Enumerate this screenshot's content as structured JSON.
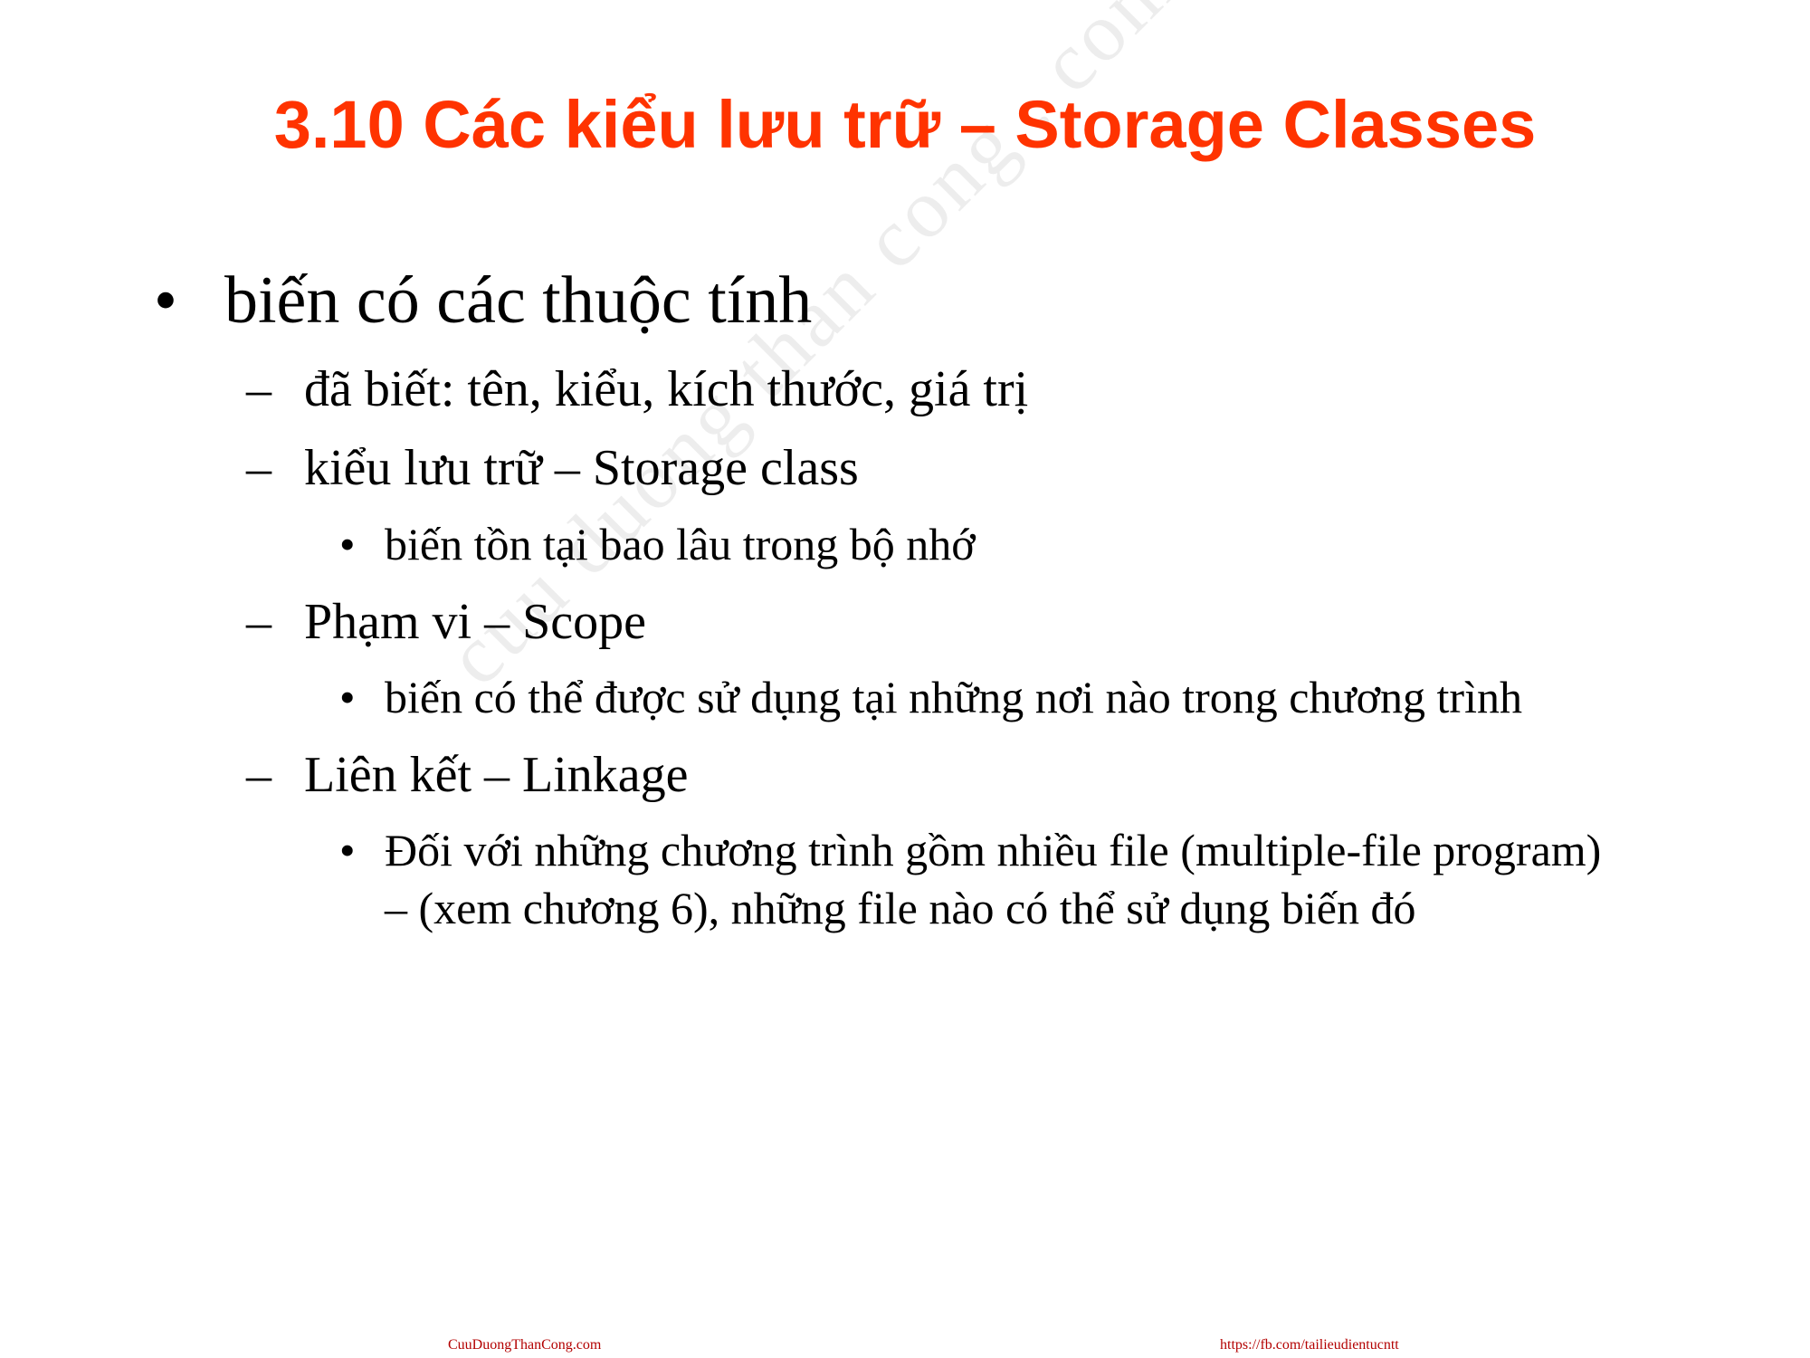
{
  "slide": {
    "title": "3.10 Các kiểu lưu trữ – Storage Classes",
    "title_color": "#ff3300",
    "watermark": "cuu duong than cong . com",
    "bullets": {
      "level1_symbol": "•",
      "level2_symbol": "–",
      "level3_symbol": "•"
    },
    "items": [
      {
        "level": 1,
        "text": "biến có các thuộc tính"
      },
      {
        "level": 2,
        "text": "đã biết: tên, kiểu, kích thước, giá trị"
      },
      {
        "level": 2,
        "text": "kiểu lưu trữ – Storage class"
      },
      {
        "level": 3,
        "text": "biến tồn tại bao lâu trong bộ nhớ"
      },
      {
        "level": 2,
        "text": "Phạm vi – Scope"
      },
      {
        "level": 3,
        "text": "biến có thể được sử dụng tại những nơi nào trong chương trình"
      },
      {
        "level": 2,
        "text": "Liên kết – Linkage"
      },
      {
        "level": 3,
        "text": "Đối với những chương trình gồm nhiều file (multiple-file program) – (xem chương 6), những file nào có thể sử dụng biến đó"
      }
    ],
    "footer": {
      "left": "CuuDuongThanCong.com",
      "right": "https://fb.com/tailieudientucntt",
      "color": "#b30000"
    }
  }
}
